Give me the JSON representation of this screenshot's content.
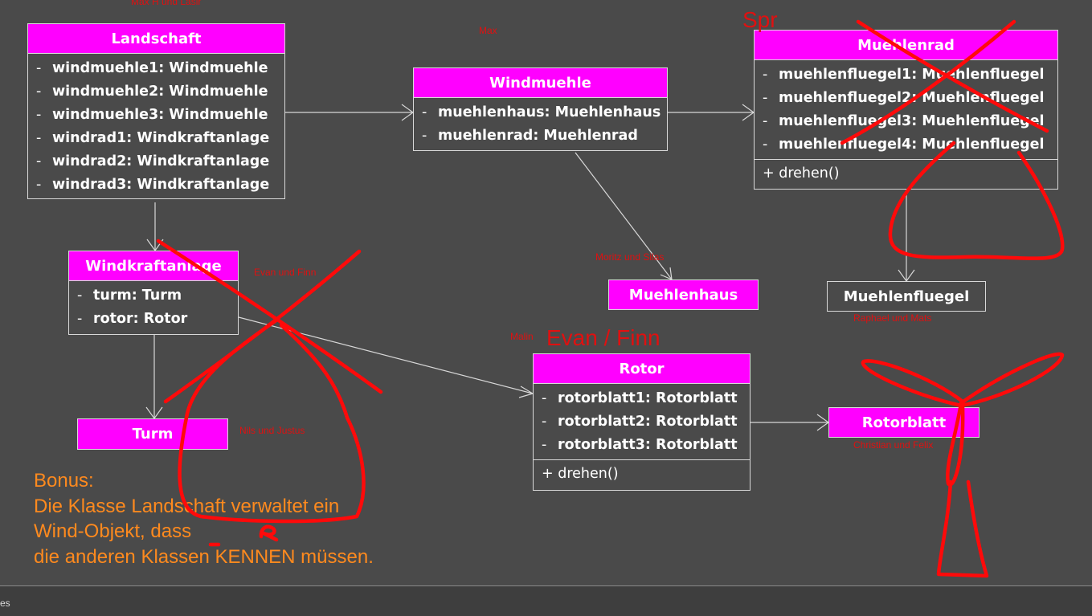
{
  "classes": {
    "landschaft": {
      "name": "Landschaft",
      "attributes": [
        {
          "vis": "-",
          "text": "windmuehle1: Windmuehle"
        },
        {
          "vis": "-",
          "text": "windmuehle2: Windmuehle"
        },
        {
          "vis": "-",
          "text": "windmuehle3: Windmuehle"
        },
        {
          "vis": "-",
          "text": "windrad1: Windkraftanlage"
        },
        {
          "vis": "-",
          "text": "windrad2: Windkraftanlage"
        },
        {
          "vis": "-",
          "text": "windrad3: Windkraftanlage"
        }
      ]
    },
    "windmuehle": {
      "name": "Windmuehle",
      "attributes": [
        {
          "vis": "-",
          "text": "muehlenhaus: Muehlenhaus"
        },
        {
          "vis": "-",
          "text": "muehlenrad: Muehlenrad"
        }
      ]
    },
    "muehlenrad": {
      "name": "Muehlenrad",
      "attributes": [
        {
          "vis": "-",
          "text": "muehlenfluegel1: Muehlenfluegel"
        },
        {
          "vis": "-",
          "text": "muehlenfluegel2: Muehlenfluegel"
        },
        {
          "vis": "-",
          "text": "muehlenfluegel3: Muehlenfluegel"
        },
        {
          "vis": "-",
          "text": "muehlenfluegel4: Muehlenfluegel"
        }
      ],
      "method": "+ drehen()"
    },
    "windkraftanlage": {
      "name": "Windkraftanlage",
      "attributes": [
        {
          "vis": "-",
          "text": "turm: Turm"
        },
        {
          "vis": "-",
          "text": "rotor: Rotor"
        }
      ]
    },
    "muehlenhaus": {
      "name": "Muehlenhaus"
    },
    "muehlenfluegel": {
      "name": "Muehlenfluegel"
    },
    "rotor": {
      "name": "Rotor",
      "attributes": [
        {
          "vis": "-",
          "text": "rotorblatt1: Rotorblatt"
        },
        {
          "vis": "-",
          "text": "rotorblatt2: Rotorblatt"
        },
        {
          "vis": "-",
          "text": "rotorblatt3: Rotorblatt"
        }
      ],
      "method": "+ drehen()"
    },
    "turm": {
      "name": "Turm"
    },
    "rotorblatt": {
      "name": "Rotorblatt"
    }
  },
  "notes": {
    "top_landschaft": "Max H und Lasir",
    "windmuehle": "Max",
    "muehlenrad_spr": "Spr",
    "windkraftanlage": "Evan und Finn",
    "muehlenhaus": "Moritz und Silas",
    "muehlenfluegel": "Raphael und Mats",
    "rotor_small": "Malin",
    "rotor_big": "Evan / Finn",
    "turm": "Nils und Justus",
    "rotorblatt": "Christian und Felix"
  },
  "bonus": {
    "line1": "Bonus:",
    "line2": "Die Klasse Landschaft verwaltet ein",
    "line3": "Wind-Objekt, dass",
    "line4": "die anderen Klassen KENNEN müssen."
  },
  "statusbar": {
    "tab_fragment": "es"
  },
  "colors": {
    "background": "#4a4a4a",
    "class_header": "#ff00ff",
    "annotation_red": "#e01010",
    "bonus_orange": "#ff8a1e",
    "connector": "#d8d8d8"
  }
}
